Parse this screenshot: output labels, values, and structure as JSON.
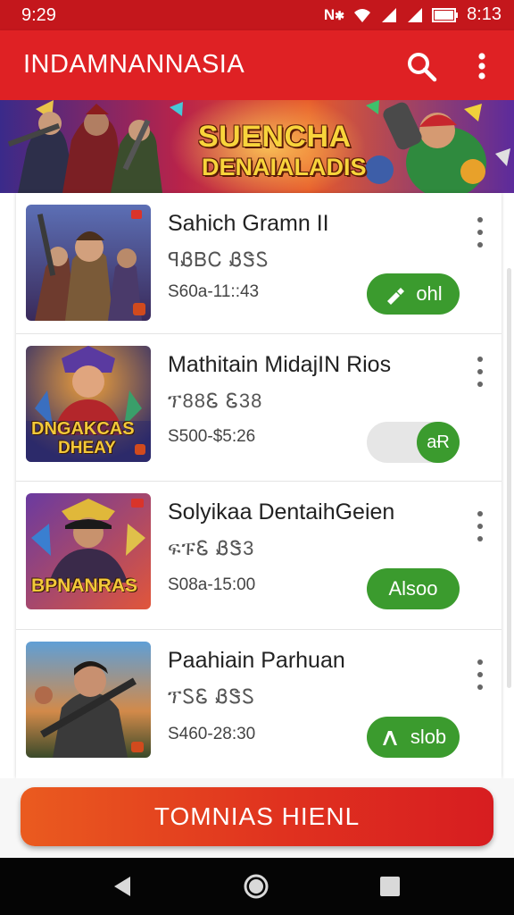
{
  "status_bar": {
    "time": "9:29",
    "right_time": "8:13"
  },
  "app_bar": {
    "title": "INDAMNANNASIA",
    "search_icon": "search-icon",
    "more_icon": "more-vert-icon"
  },
  "banner": {
    "line1": "SUENCHA",
    "line2": "DENAIALADIS"
  },
  "colors": {
    "primary": "#df2124",
    "status": "#c4171c",
    "green": "#3b9b2e",
    "cta_start": "#ea5b1f",
    "cta_end": "#d71d20"
  },
  "games": [
    {
      "name": "Sahich Gramn II",
      "sub": "ꟼᏰᏴᏟ ᏰᏕᏚ",
      "meta": "S60a-11::43",
      "action": {
        "type": "button",
        "label": "ohl",
        "icon": "pencil-arrow-icon"
      }
    },
    {
      "name": "Mathitain MidajIN Rios",
      "sub": "ፕ88Ꮛ Ꮛ38",
      "meta": "S500-$5:26",
      "action": {
        "type": "toggle",
        "label": "aɌ",
        "state": "on"
      },
      "thumb_text": [
        "DNGAKCAS",
        "DHEAY"
      ]
    },
    {
      "name": "Solyikaa DentaihGeien",
      "sub": "ፍፑᏋ ᏰᏕ3",
      "meta": "S08a-15:00",
      "action": {
        "type": "button",
        "label": "Alsoo",
        "icon": ""
      },
      "thumb_text": [
        "BPNANRAS"
      ]
    },
    {
      "name": "Paahiain Parhuan",
      "sub": "ፕᏚᏋ ᏰᏕᏚ",
      "meta": "S460-28:30",
      "action": {
        "type": "button",
        "label": "slob",
        "icon": "pencil-icon"
      }
    }
  ],
  "cta": {
    "label": "TOMNIAS HIENL"
  },
  "nav": {
    "back": "back-icon",
    "home": "home-icon",
    "recents": "recents-icon"
  }
}
